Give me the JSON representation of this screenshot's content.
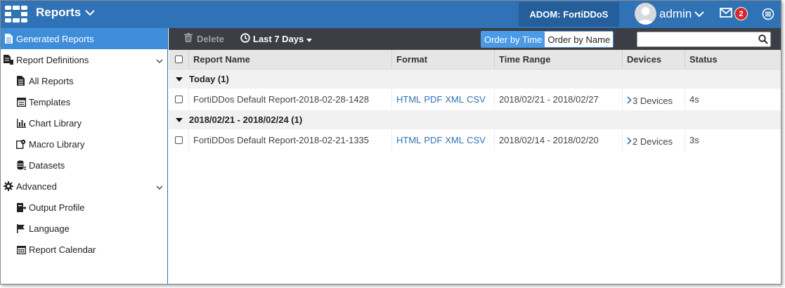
{
  "header": {
    "app_title": "Reports",
    "adom_label": "ADOM: FortiDDoS",
    "user_name": "admin",
    "notification_count": "2",
    "colors": {
      "bar": "#2f72b5",
      "adom_bg": "#245f9c",
      "badge": "#d7262d"
    }
  },
  "sidebar": {
    "items": [
      {
        "label": "Generated Reports",
        "icon": "report-icon",
        "active": true
      },
      {
        "label": "Report Definitions",
        "icon": "report-definitions-icon"
      },
      {
        "label": "All Reports",
        "icon": "document-icon"
      },
      {
        "label": "Templates",
        "icon": "templates-icon"
      },
      {
        "label": "Chart Library",
        "icon": "bar-chart-icon"
      },
      {
        "label": "Macro Library",
        "icon": "macro-icon"
      },
      {
        "label": "Datasets",
        "icon": "datasets-icon"
      },
      {
        "label": "Advanced",
        "icon": "gear-icon"
      },
      {
        "label": "Output Profile",
        "icon": "output-profile-icon"
      },
      {
        "label": "Language",
        "icon": "flag-icon"
      },
      {
        "label": "Report Calendar",
        "icon": "calendar-icon"
      }
    ],
    "active_color": "#3e8ddb"
  },
  "toolbar": {
    "delete_label": "Delete",
    "range_label": "Last 7 Days",
    "order_by_time": "Order by Time",
    "order_by_name": "Order by Name",
    "search_placeholder": "",
    "colors": {
      "bg": "#3b3e44",
      "order_active": "#4a9ae8"
    }
  },
  "table": {
    "columns": [
      "Report Name",
      "Format",
      "Time Range",
      "Devices",
      "Status"
    ],
    "groups": [
      {
        "label": "Today (1)",
        "rows": [
          {
            "name": "FortiDDos Default Report-2018-02-28-1428",
            "formats": [
              "HTML",
              "PDF",
              "XML",
              "CSV"
            ],
            "time_range": "2018/02/21 - 2018/02/27",
            "devices": "3 Devices",
            "status": "4s"
          }
        ]
      },
      {
        "label": "2018/02/21 - 2018/02/24 (1)",
        "rows": [
          {
            "name": "FortiDDos Default Report-2018-02-21-1335",
            "formats": [
              "HTML",
              "PDF",
              "XML",
              "CSV"
            ],
            "time_range": "2018/02/14 - 2018/02/20",
            "devices": "2 Devices",
            "status": "3s"
          }
        ]
      }
    ]
  }
}
